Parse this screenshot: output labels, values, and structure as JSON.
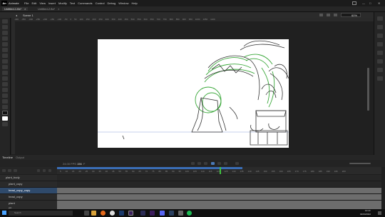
{
  "app": {
    "logo": "An",
    "name": "Animate",
    "menu": [
      "File",
      "Edit",
      "View",
      "Insert",
      "Modify",
      "Text",
      "Commands",
      "Control",
      "Debug",
      "Window",
      "Help"
    ],
    "workspace_icon": "workspace-icon",
    "window_buttons": [
      "minimize",
      "maximize",
      "close"
    ]
  },
  "tabs": {
    "active": "Untitled-1.fla*",
    "inactive": "Untitled-2.fla*"
  },
  "scene": {
    "name": "Scene 1",
    "zoom": "60%",
    "icons": [
      "edit-symbol-icon",
      "scene-icon",
      "clip-icon",
      "center-stage-icon"
    ]
  },
  "ruler": {
    "ticks": [
      "-400",
      "-350",
      "-300",
      "-250",
      "-200",
      "-150",
      "-100",
      "-50",
      "0",
      "50",
      "100",
      "150",
      "200",
      "250",
      "300",
      "350",
      "400",
      "450",
      "500",
      "550",
      "600",
      "650",
      "700",
      "750",
      "800",
      "850",
      "900",
      "950",
      "1000",
      "1050",
      "1100"
    ]
  },
  "timeline": {
    "tabs": [
      "Timeline",
      "Output"
    ],
    "fps": "24.00 FPS",
    "frame": "156",
    "frame_suffix": "F",
    "layers_header": "Layers",
    "ruler_ticks": [
      "5",
      "10",
      "15",
      "20",
      "25",
      "30",
      "35",
      "40",
      "45",
      "50",
      "55",
      "60",
      "65",
      "70",
      "75",
      "80",
      "85",
      "90",
      "95",
      "100",
      "105",
      "110",
      "115",
      "120",
      "125",
      "130",
      "135",
      "140",
      "145",
      "150",
      "155",
      "160",
      "165",
      "170",
      "175",
      "180",
      "185",
      "190",
      "195",
      "200"
    ],
    "layers": [
      {
        "name": "plant_body",
        "selected": false
      },
      {
        "name": "plant_copy",
        "selected": false
      },
      {
        "name": "head_copy_copy",
        "selected": true
      },
      {
        "name": "head_copy",
        "selected": false
      },
      {
        "name": "plant",
        "selected": false
      },
      {
        "name": "pot",
        "selected": false
      }
    ]
  },
  "taskbar": {
    "search_placeholder": "Search",
    "time": "10:44",
    "date": "02/04/2022"
  }
}
